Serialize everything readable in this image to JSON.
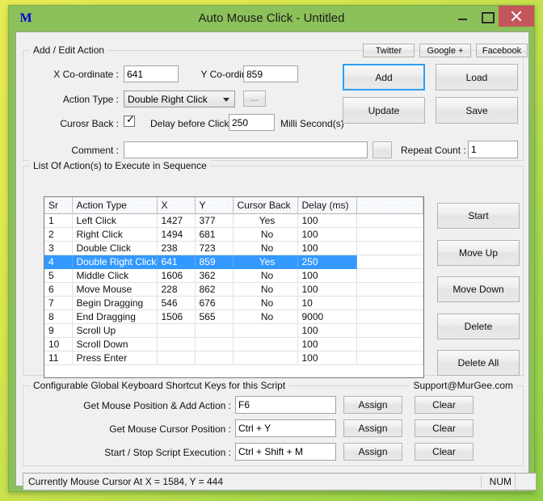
{
  "window": {
    "title": "Auto Mouse Click - Untitled",
    "icon": "M",
    "minimize": "minimize",
    "maximize": "maximize",
    "close": "close",
    "frame_color": "#8cc059",
    "close_color": "#c4565b"
  },
  "social": [
    {
      "label": "Twitter"
    },
    {
      "label": "Google +"
    },
    {
      "label": "Facebook"
    }
  ],
  "add_edit": {
    "legend": "Add / Edit Action",
    "x_label": "X Co-ordinate :",
    "x_value": "641",
    "y_label": "Y Co-ordinate :",
    "y_value": "859",
    "action_type_label": "Action Type :",
    "action_type_value": "Double Right Click",
    "action_type_options": [
      "Left Click",
      "Right Click",
      "Double Click",
      "Double Right Click",
      "Middle Click",
      "Move Mouse",
      "Begin Dragging",
      "End Dragging",
      "Scroll Up",
      "Scroll Down",
      "Press Enter"
    ],
    "ellipsis_label": "...",
    "cursor_back_label": "Curosr Back :",
    "cursor_back_checked": true,
    "delay_label": "Delay before Click :",
    "delay_value": "250",
    "delay_units": "Milli Second(s)",
    "comment_label": "Comment :",
    "comment_value": "",
    "comment_browse_label": "",
    "repeat_label": "Repeat Count :",
    "repeat_value": "1",
    "add_label": "Add",
    "load_label": "Load",
    "update_label": "Update",
    "save_label": "Save"
  },
  "list_section": {
    "legend": "List Of Action(s) to Execute in Sequence",
    "columns": [
      "Sr",
      "Action Type",
      "X",
      "Y",
      "Cursor Back",
      "Delay (ms)",
      ""
    ],
    "selected_row_index": 3,
    "rows": [
      {
        "sr": "1",
        "action": "Left Click",
        "x": "1427",
        "y": "377",
        "cursor_back": "Yes",
        "delay": "100"
      },
      {
        "sr": "2",
        "action": "Right Click",
        "x": "1494",
        "y": "681",
        "cursor_back": "No",
        "delay": "100"
      },
      {
        "sr": "3",
        "action": "Double Click",
        "x": "238",
        "y": "723",
        "cursor_back": "No",
        "delay": "100"
      },
      {
        "sr": "4",
        "action": "Double Right Click",
        "x": "641",
        "y": "859",
        "cursor_back": "Yes",
        "delay": "250"
      },
      {
        "sr": "5",
        "action": "Middle Click",
        "x": "1606",
        "y": "362",
        "cursor_back": "No",
        "delay": "100"
      },
      {
        "sr": "6",
        "action": "Move Mouse",
        "x": "228",
        "y": "862",
        "cursor_back": "No",
        "delay": "100"
      },
      {
        "sr": "7",
        "action": "Begin Dragging",
        "x": "546",
        "y": "676",
        "cursor_back": "No",
        "delay": "10"
      },
      {
        "sr": "8",
        "action": "End Dragging",
        "x": "1506",
        "y": "565",
        "cursor_back": "No",
        "delay": "9000"
      },
      {
        "sr": "9",
        "action": "Scroll Up",
        "x": "",
        "y": "",
        "cursor_back": "",
        "delay": "100"
      },
      {
        "sr": "10",
        "action": "Scroll Down",
        "x": "",
        "y": "",
        "cursor_back": "",
        "delay": "100"
      },
      {
        "sr": "11",
        "action": "Press Enter",
        "x": "",
        "y": "",
        "cursor_back": "",
        "delay": "100"
      }
    ],
    "buttons": {
      "start": "Start",
      "move_up": "Move Up",
      "move_down": "Move Down",
      "delete": "Delete",
      "delete_all": "Delete All"
    }
  },
  "shortcuts": {
    "legend": "Configurable Global Keyboard Shortcut Keys for this Script",
    "support": "Support@MurGee.com",
    "rows": [
      {
        "label": "Get Mouse Position & Add Action :",
        "value": "F6",
        "assign": "Assign",
        "clear": "Clear"
      },
      {
        "label": "Get Mouse Cursor Position :",
        "value": "Ctrl + Y",
        "assign": "Assign",
        "clear": "Clear"
      },
      {
        "label": "Start / Stop Script Execution :",
        "value": "Ctrl + Shift + M",
        "assign": "Assign",
        "clear": "Clear"
      }
    ]
  },
  "statusbar": {
    "text": "Currently Mouse Cursor At X = 1584, Y = 444",
    "num": "NUM"
  }
}
